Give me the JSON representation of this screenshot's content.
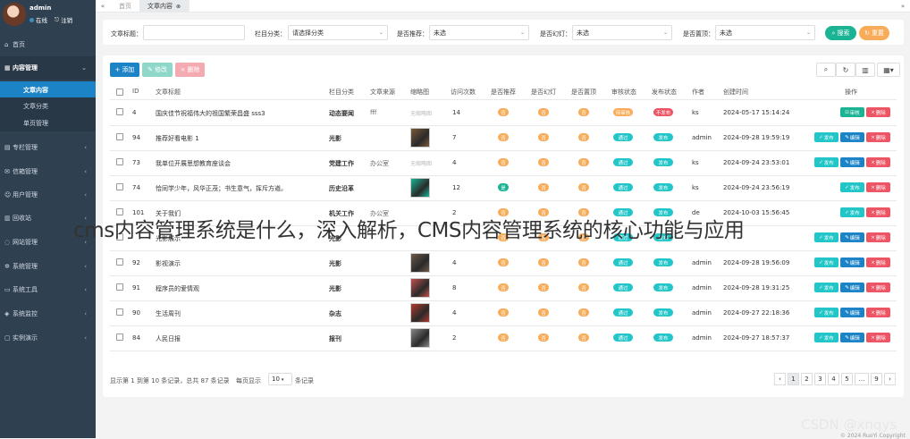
{
  "sidebar": {
    "user": {
      "name": "admin",
      "status": "在线",
      "logout": "注销"
    },
    "items": [
      {
        "label": "首页",
        "icon": "home-icon",
        "glyph": "⌂",
        "expanded": false
      },
      {
        "label": "内容管理",
        "icon": "columns-icon",
        "glyph": "▦",
        "expanded": true,
        "children": [
          {
            "label": "文章内容",
            "active": true
          },
          {
            "label": "文章分类",
            "active": false
          },
          {
            "label": "单页管理",
            "active": false
          }
        ]
      },
      {
        "label": "专栏管理",
        "icon": "bookmark-icon",
        "glyph": "▤",
        "expanded": false
      },
      {
        "label": "信箱管理",
        "icon": "envelope-icon",
        "glyph": "✉",
        "expanded": false
      },
      {
        "label": "用户管理",
        "icon": "user-icon",
        "glyph": "☺",
        "expanded": false
      },
      {
        "label": "回收站",
        "icon": "trash-icon",
        "glyph": "▥",
        "expanded": false
      },
      {
        "label": "网站管理",
        "icon": "globe-icon",
        "glyph": "◌",
        "expanded": false
      },
      {
        "label": "系统管理",
        "icon": "cog-icon",
        "glyph": "✲",
        "expanded": false
      },
      {
        "label": "系统工具",
        "icon": "wrench-icon",
        "glyph": "▭",
        "expanded": false
      },
      {
        "label": "系统监控",
        "icon": "monitor-icon",
        "glyph": "◈",
        "expanded": false
      },
      {
        "label": "实例演示",
        "icon": "desktop-icon",
        "glyph": "▢",
        "expanded": false
      }
    ]
  },
  "topbar": {
    "tabs": [
      {
        "label": "首页",
        "active": false
      },
      {
        "label": "文章内容",
        "active": true
      }
    ]
  },
  "filters": {
    "title_label": "文章标题：",
    "column_label": "栏目分类：",
    "column_value": "请选择分类",
    "recommend_label": "是否推荐：",
    "recommend_value": "未选",
    "slide_label": "是否幻灯：",
    "slide_value": "未选",
    "top_label": "是否置顶：",
    "top_value": "未选",
    "search_label": "搜索",
    "reset_label": "重置"
  },
  "toolbar": {
    "add": "添加",
    "edit": "修改",
    "delete": "删除"
  },
  "table": {
    "headers": [
      "ID",
      "文章标题",
      "栏目分类",
      "文章来源",
      "缩略图",
      "访问次数",
      "是否推荐",
      "是否幻灯",
      "是否置顶",
      "审核状态",
      "发布状态",
      "作者",
      "创建时间",
      "操作"
    ],
    "rows": [
      {
        "id": "4",
        "title": "国庆佳节祝福伟大的祖国繁荣昌盛 sss3",
        "category": "动态要闻",
        "source": "fff",
        "thumb": "无缩略图",
        "views": "14",
        "rec": "否",
        "rec_color": "#f8ac59",
        "slide": "否",
        "top": "否",
        "audit": "待审核",
        "audit_color": "#f8ac59",
        "publish": "不发布",
        "publish_color": "#ed5565",
        "author": "ks",
        "time": "2024-05-17 15:14:24",
        "actions": [
          "审核",
          "删除"
        ]
      },
      {
        "id": "94",
        "title": "推荐好看电影 1",
        "category": "光影",
        "source": "",
        "thumb": "img",
        "thumb_color": "#7a5a3a",
        "views": "7",
        "rec": "否",
        "rec_color": "#f8ac59",
        "slide": "否",
        "top": "否",
        "audit": "通过",
        "audit_color": "#23c6c8",
        "publish": "发布",
        "publish_color": "#23c6c8",
        "author": "admin",
        "time": "2024-09-28 19:59:19",
        "actions": [
          "发布",
          "编辑",
          "删除"
        ]
      },
      {
        "id": "73",
        "title": "我单位开展思想教育座谈会",
        "category": "党建工作",
        "source": "办公室",
        "thumb": "无缩略图",
        "views": "4",
        "rec": "否",
        "rec_color": "#f8ac59",
        "slide": "否",
        "top": "否",
        "audit": "通过",
        "audit_color": "#23c6c8",
        "publish": "发布",
        "publish_color": "#23c6c8",
        "author": "ks",
        "time": "2024-09-24 23:53:01",
        "actions": [
          "发布",
          "编辑",
          "删除"
        ]
      },
      {
        "id": "74",
        "title": "恰同学少年，风华正茂；书生意气，挥斥方遒。",
        "category": "历史沿革",
        "source": "",
        "thumb": "img",
        "thumb_color": "#1ab394",
        "views": "12",
        "rec": "是",
        "rec_color": "#1ab394",
        "slide": "否",
        "top": "否",
        "audit": "通过",
        "audit_color": "#23c6c8",
        "publish": "发布",
        "publish_color": "#23c6c8",
        "author": "ks",
        "time": "2024-09-24 23:56:19",
        "actions": [
          "发布",
          "删除"
        ]
      },
      {
        "id": "101",
        "title": "关于我们",
        "category": "机关工作",
        "source": "办公室",
        "thumb": "",
        "views": "2",
        "rec": "否",
        "rec_color": "#f8ac59",
        "slide": "否",
        "top": "否",
        "audit": "通过",
        "audit_color": "#23c6c8",
        "publish": "发布",
        "publish_color": "#23c6c8",
        "author": "de",
        "time": "2024-10-03 15:56:45",
        "actions": [
          "发布",
          "删除"
        ]
      },
      {
        "id": "",
        "title": "光影展示",
        "category": "光影",
        "source": "",
        "thumb": "",
        "views": "",
        "rec": "否",
        "rec_color": "#f8ac59",
        "slide": "否",
        "top": "否",
        "audit": "通过",
        "audit_color": "#23c6c8",
        "publish": "发布",
        "publish_color": "#23c6c8",
        "author": "",
        "time": "",
        "actions": [
          "发布",
          "编辑",
          "删除"
        ]
      },
      {
        "id": "92",
        "title": "影视演示",
        "category": "光影",
        "source": "",
        "thumb": "img",
        "thumb_color": "#6b5a4a",
        "views": "4",
        "rec": "否",
        "rec_color": "#f8ac59",
        "slide": "否",
        "top": "否",
        "audit": "通过",
        "audit_color": "#23c6c8",
        "publish": "发布",
        "publish_color": "#23c6c8",
        "author": "admin",
        "time": "2024-09-28 19:56:09",
        "actions": [
          "发布",
          "编辑",
          "删除"
        ]
      },
      {
        "id": "91",
        "title": "程序员的爱情观",
        "category": "光影",
        "source": "",
        "thumb": "img",
        "thumb_color": "#c0504d",
        "views": "8",
        "rec": "否",
        "rec_color": "#f8ac59",
        "slide": "否",
        "top": "否",
        "audit": "通过",
        "audit_color": "#23c6c8",
        "publish": "发布",
        "publish_color": "#23c6c8",
        "author": "admin",
        "time": "2024-09-28 19:31:25",
        "actions": [
          "发布",
          "编辑",
          "删除"
        ]
      },
      {
        "id": "90",
        "title": "生活周刊",
        "category": "杂志",
        "source": "",
        "thumb": "img",
        "thumb_color": "#b03a2e",
        "views": "4",
        "rec": "否",
        "rec_color": "#f8ac59",
        "slide": "否",
        "top": "否",
        "audit": "通过",
        "audit_color": "#23c6c8",
        "publish": "发布",
        "publish_color": "#23c6c8",
        "author": "admin",
        "time": "2024-09-27 22:18:36",
        "actions": [
          "发布",
          "编辑",
          "删除"
        ]
      },
      {
        "id": "84",
        "title": "人民日报",
        "category": "报刊",
        "source": "",
        "thumb": "img",
        "thumb_color": "#888888",
        "views": "2",
        "rec": "否",
        "rec_color": "#f8ac59",
        "slide": "否",
        "top": "否",
        "audit": "通过",
        "audit_color": "#23c6c8",
        "publish": "发布",
        "publish_color": "#23c6c8",
        "author": "admin",
        "time": "2024-09-27 18:57:37",
        "actions": [
          "发布",
          "编辑",
          "删除"
        ]
      }
    ]
  },
  "pagination": {
    "summary": "显示第 1 到第 10 条记录，总共 87 条记录",
    "per_page_label": "每页显示",
    "per_page_value": "10",
    "per_page_suffix": "条记录",
    "pages": [
      "‹",
      "1",
      "2",
      "3",
      "4",
      "5",
      "...",
      "9",
      "›"
    ],
    "active_page": "1"
  },
  "overlay_caption": "cms内容管理系统是什么，深入解析，CMS内容管理系统的核心功能与应用",
  "watermark": "CSDN @xnqys",
  "copyright": "© 2024 RuoYi Copyright",
  "colors": {
    "primary": "#1ab394",
    "blue": "#1c84c6",
    "danger": "#ed5565",
    "warning": "#f8ac59",
    "info": "#23c6c8",
    "sidebar": "#2f4050"
  }
}
